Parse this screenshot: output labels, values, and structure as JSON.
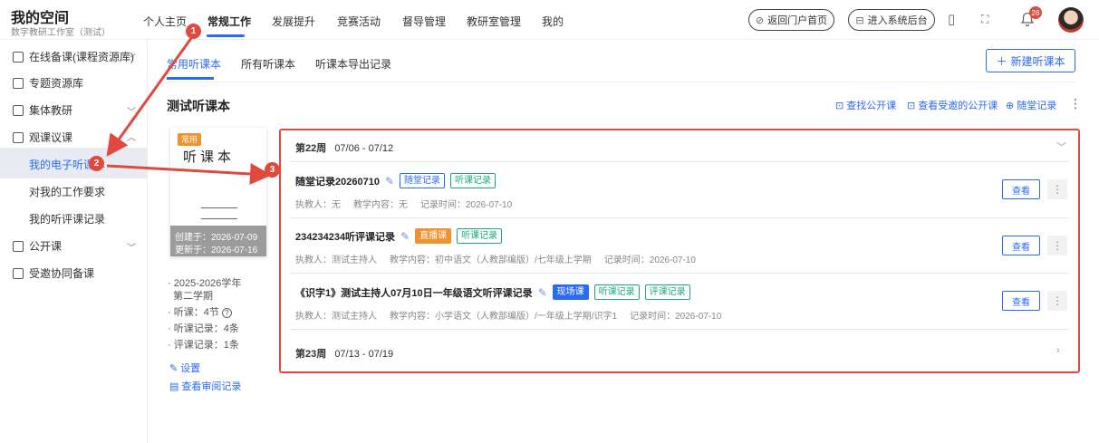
{
  "brand": {
    "title": "我的空间",
    "subtitle": "数字教研工作室（测试）"
  },
  "nav": {
    "items": [
      "个人主页",
      "常规工作",
      "发展提升",
      "竞赛活动",
      "督导管理",
      "教研室管理",
      "我的"
    ],
    "active_index": 1
  },
  "header_actions": {
    "portal": "返回门户首页",
    "backend": "进入系统后台",
    "bell_count": "28"
  },
  "sidebar": {
    "items": [
      {
        "label": "在线备课(课程资源库)"
      },
      {
        "label": "专题资源库"
      },
      {
        "label": "集体教研"
      },
      {
        "label": "观课议课"
      },
      {
        "label": "公开课"
      },
      {
        "label": "受邀协同备课"
      }
    ],
    "sub_items": [
      "我的电子听课本",
      "对我的工作要求",
      "我的听评课记录"
    ],
    "active_sub": 0
  },
  "tabs": {
    "items": [
      "常用听课本",
      "所有听课本",
      "听课本导出记录"
    ],
    "active_index": 0
  },
  "new_button": "新建听课本",
  "page_title": "测试听课本",
  "toolbar": {
    "find": "查找公开课",
    "invited": "查看受邀的公开课",
    "quick": "随堂记录"
  },
  "book": {
    "tag": "常用",
    "title": "听课本",
    "created": "创建于：2026-07-09",
    "updated": "更新于：2026-07-16"
  },
  "book_info": {
    "term_line1": "· 2025-2026学年",
    "term_line2": "第二学期",
    "lessons": "· 听课：4节",
    "listen_records": "· 听课记录：4条",
    "review_records": "· 评课记录：1条",
    "settings": "设置",
    "audit": "查看审阅记录"
  },
  "weeks": [
    {
      "label": "第22周",
      "range": "07/06 - 07/12"
    },
    {
      "label": "第23周",
      "range": "07/13 - 07/19"
    }
  ],
  "records": [
    {
      "title": "随堂记录20260710",
      "tags": [
        "随堂记录",
        "听课记录"
      ],
      "teacher": "执教人：无",
      "content": "教学内容：无",
      "time": "记录时间：2026-07-10",
      "view": "查看"
    },
    {
      "title": "234234234听评课记录",
      "tags": [
        "直播课",
        "听课记录"
      ],
      "teacher": "执教人：测试主持人",
      "content": "教学内容：初中语文（人教部编版）/七年级上学期",
      "time": "记录时间：2026-07-10",
      "view": "查看"
    },
    {
      "title": "《识字1》测试主持人07月10日一年级语文听评课记录",
      "tags": [
        "现场课",
        "听课记录",
        "评课记录"
      ],
      "teacher": "执教人：测试主持人",
      "content": "教学内容：小学语文（人教部编版）/一年级上学期/识字1",
      "time": "记录时间：2026-07-10",
      "view": "查看"
    }
  ],
  "steps": [
    "1",
    "2",
    "3"
  ],
  "colors": {
    "accent": "#2b6bf3",
    "annotation": "#e04a3e",
    "tag_orange": "#f0922d",
    "tag_green": "#1aaa76"
  }
}
